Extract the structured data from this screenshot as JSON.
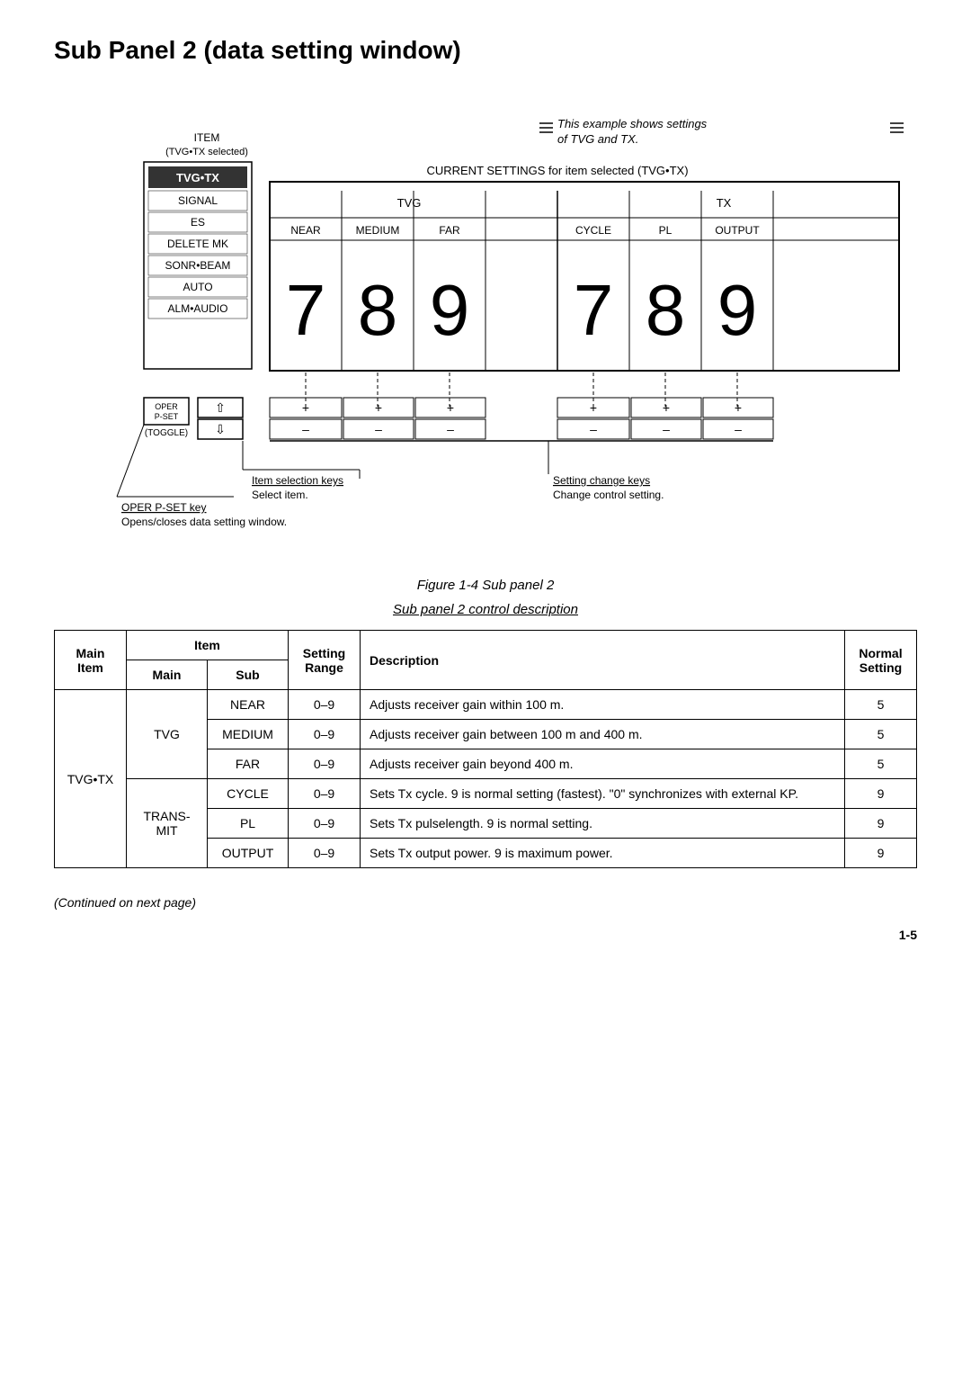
{
  "page": {
    "title": "Sub Panel 2 (data setting window)",
    "figure_caption": "Figure 1-4 Sub panel 2",
    "table_caption": "Sub panel 2 control description",
    "continued": "(Continued on next page)",
    "page_number": "1-5"
  },
  "diagram": {
    "note_top": "This example shows settings of TVG and TX.",
    "item_label": "ITEM",
    "item_sub": "(TVG•TX selected)",
    "current_settings": "CURRENT SETTINGS for item selected (TVG•TX)",
    "menu_items": [
      "TVG•TX",
      "SIGNAL",
      "ES",
      "DELETE MK",
      "SONR•BEAM",
      "AUTO",
      "ALM•AUDIO"
    ],
    "tvg_label": "TVG",
    "tx_label": "TX",
    "tvg_subs": [
      "NEAR",
      "MEDIUM",
      "FAR"
    ],
    "tx_subs": [
      "CYCLE",
      "PL",
      "OUTPUT"
    ],
    "tvg_values": [
      "7",
      "8",
      "9"
    ],
    "tx_values": [
      "7",
      "8",
      "9"
    ],
    "oper_label": "OPER\nP-SET",
    "toggle_label": "(TOGGLE)",
    "item_sel_label": "Item selection keys",
    "item_sel_sub": "Select item.",
    "setting_change_label": "Setting change keys",
    "setting_change_sub": "Change control setting.",
    "oper_pset_label": "OPER P-SET key",
    "oper_pset_sub": "Opens/closes data setting window.",
    "plus_signs": [
      "+",
      "+",
      "+",
      "+",
      "+",
      "+"
    ],
    "minus_signs": [
      "–",
      "–",
      "–",
      "–",
      "–",
      "–"
    ]
  },
  "table": {
    "headers": {
      "main_item": "Main\nItem",
      "item_main": "Main",
      "item_sub_col": "Sub",
      "item_group": "Item",
      "setting_range": "Setting\nRange",
      "description": "Description",
      "normal_setting": "Normal\nSetting"
    },
    "rows": [
      {
        "main_item": "TVG•TX",
        "item_main": "TVG",
        "item_sub": "NEAR",
        "setting_range": "0–9",
        "description": "Adjusts receiver gain within 100 m.",
        "normal_setting": "5"
      },
      {
        "main_item": "",
        "item_main": "",
        "item_sub": "MEDIUM",
        "setting_range": "0–9",
        "description": "Adjusts receiver gain between 100 m and 400 m.",
        "normal_setting": "5"
      },
      {
        "main_item": "",
        "item_main": "",
        "item_sub": "FAR",
        "setting_range": "0–9",
        "description": "Adjusts receiver gain beyond 400 m.",
        "normal_setting": "5"
      },
      {
        "main_item": "",
        "item_main": "TRANS-\nMIT",
        "item_sub": "CYCLE",
        "setting_range": "0–9",
        "description": "Sets Tx cycle. 9 is normal setting (fastest). \"0\" synchronizes with external KP.",
        "normal_setting": "9"
      },
      {
        "main_item": "",
        "item_main": "",
        "item_sub": "PL",
        "setting_range": "0–9",
        "description": "Sets Tx pulselength. 9 is normal setting.",
        "normal_setting": "9"
      },
      {
        "main_item": "",
        "item_main": "",
        "item_sub": "OUTPUT",
        "setting_range": "0–9",
        "description": "Sets Tx output power. 9 is maximum power.",
        "normal_setting": "9"
      }
    ]
  }
}
